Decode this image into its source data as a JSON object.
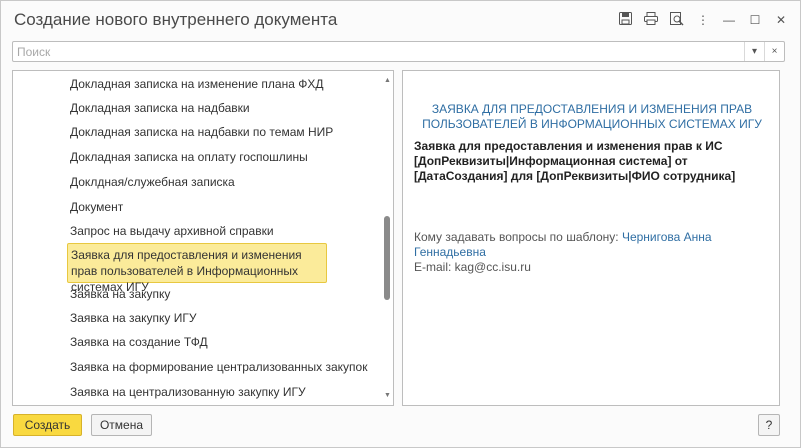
{
  "window": {
    "title": "Создание нового внутреннего документа"
  },
  "title_icons": [
    "save-icon",
    "print-icon",
    "print-preview-icon",
    "more-icon",
    "minimize-icon",
    "maximize-icon",
    "close-icon"
  ],
  "title_glyphs": {
    "more": "⋮",
    "minimize": "—",
    "maximize": "☐",
    "close": "✕"
  },
  "search": {
    "placeholder": "Поиск",
    "dropdown_glyph": "▾",
    "clear_glyph": "×"
  },
  "templates": {
    "items": [
      "Докладная записка на изменение плана ФХД",
      "Докладная записка на надбавки",
      "Докладная записка на надбавки по темам НИР",
      "Докладная записка на оплату госпошлины",
      "Доклдная/служебная записка",
      "Документ",
      "Запрос на выдачу архивной справки",
      "Заявка для предоставления и изменения прав пользователей в Информационных системах ИГУ",
      "Заявка на закупку",
      "Заявка на закупку ИГУ",
      "Заявка на создание ТФД",
      "Заявка на формирование централизованных закупок",
      "Заявка на централизованную закупку ИГУ"
    ],
    "selected_index": 7
  },
  "preview": {
    "heading": "ЗАЯВКА ДЛЯ ПРЕДОСТАВЛЕНИЯ И ИЗМЕНЕНИЯ ПРАВ ПОЛЬЗОВАТЕЛЕЙ В ИНФОРМАЦИОННЫХ СИСТЕМАХ ИГУ",
    "subject": "Заявка для предоставления и изменения прав к ИС [ДопРеквизиты|Информационная система] от [ДатаСоздания] для [ДопРеквизиты|ФИО сотрудника]",
    "contact_label": "Кому задавать вопросы по шаблону:",
    "contact_name": "Чернигова Анна Геннадьевна",
    "email": "E-mail: kag@cc.isu.ru"
  },
  "buttons": {
    "create": "Создать",
    "cancel": "Отмена",
    "help": "?"
  },
  "colors": {
    "accent": "#f9d940",
    "selection": "#fbeb9a",
    "link": "#2f6ea3"
  }
}
